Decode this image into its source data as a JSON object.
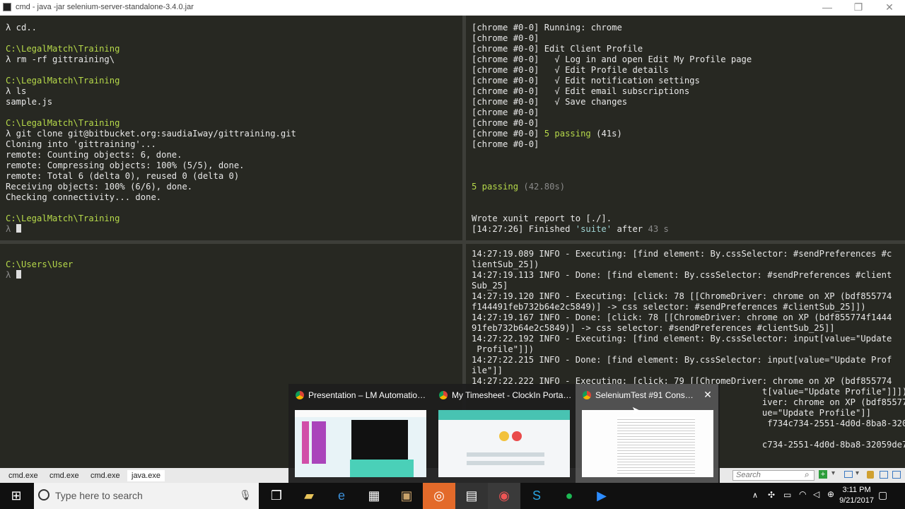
{
  "window": {
    "title": "cmd - java  -jar selenium-server-standalone-3.4.0.jar",
    "min_glyph": "—",
    "max_glyph": "❐",
    "close_glyph": "✕"
  },
  "top_left": [
    {
      "t": "λ cd..",
      "c": ""
    },
    {
      "t": "",
      "c": ""
    },
    {
      "t": "C:\\LegalMatch\\Training",
      "c": "green"
    },
    {
      "t": "λ rm -rf gittraining\\",
      "c": ""
    },
    {
      "t": "",
      "c": ""
    },
    {
      "t": "C:\\LegalMatch\\Training",
      "c": "green"
    },
    {
      "t": "λ ls",
      "c": ""
    },
    {
      "t": "sample.js",
      "c": ""
    },
    {
      "t": "",
      "c": ""
    },
    {
      "t": "C:\\LegalMatch\\Training",
      "c": "green"
    },
    {
      "t": "λ git clone git@bitbucket.org:saudiaIway/gittraining.git",
      "c": ""
    },
    {
      "t": "Cloning into 'gittraining'...",
      "c": ""
    },
    {
      "t": "remote: Counting objects: 6, done.",
      "c": ""
    },
    {
      "t": "remote: Compressing objects: 100% (5/5), done.",
      "c": ""
    },
    {
      "t": "remote: Total 6 (delta 0), reused 0 (delta 0)",
      "c": ""
    },
    {
      "t": "Receiving objects: 100% (6/6), done.",
      "c": ""
    },
    {
      "t": "Checking connectivity... done.",
      "c": ""
    },
    {
      "t": "",
      "c": ""
    },
    {
      "t": "C:\\LegalMatch\\Training",
      "c": "green"
    }
  ],
  "top_left_prompt": "λ ",
  "top_right": [
    {
      "t": "[chrome #0-0] Running: chrome",
      "c": ""
    },
    {
      "t": "[chrome #0-0]",
      "c": ""
    },
    {
      "t": "[chrome #0-0] Edit Client Profile",
      "c": ""
    },
    {
      "t": "[chrome #0-0]   √ Log in and open Edit My Profile page",
      "c": ""
    },
    {
      "t": "[chrome #0-0]   √ Edit Profile details",
      "c": ""
    },
    {
      "t": "[chrome #0-0]   √ Edit notification settings",
      "c": ""
    },
    {
      "t": "[chrome #0-0]   √ Edit email subscriptions",
      "c": ""
    },
    {
      "t": "[chrome #0-0]   √ Save changes",
      "c": ""
    },
    {
      "t": "[chrome #0-0]",
      "c": ""
    },
    {
      "t": "[chrome #0-0]",
      "c": ""
    },
    {
      "t": "[chrome #0-0] ",
      "c": "",
      "g": "5 passing",
      "r": " (41s)"
    },
    {
      "t": "[chrome #0-0]",
      "c": ""
    },
    {
      "t": "",
      "c": ""
    },
    {
      "t": "",
      "c": ""
    },
    {
      "t": "",
      "c": ""
    },
    {
      "t": "",
      "c": "",
      "g": "5 passing",
      "r": " (42.80s)",
      "rc": "grey"
    },
    {
      "t": "",
      "c": ""
    },
    {
      "t": "",
      "c": ""
    },
    {
      "t": "Wrote xunit report to [./].",
      "c": ""
    },
    {
      "t": "[14:27:26] Finished ",
      "c": "",
      "q": "'suite'",
      "r": " after ",
      "m": "43 s"
    }
  ],
  "bottom_left": [
    {
      "t": "C:\\Users\\User",
      "c": "green"
    }
  ],
  "bottom_left_prompt": "λ ",
  "bottom_right": [
    "14:27:19.089 INFO - Executing: [find element: By.cssSelector: #sendPreferences #c",
    "lientSub_25])",
    "14:27:19.113 INFO - Done: [find element: By.cssSelector: #sendPreferences #client",
    "Sub_25]",
    "14:27:19.120 INFO - Executing: [click: 78 [[ChromeDriver: chrome on XP (bdf855774",
    "f144491feb732b64e2c5849)] -> css selector: #sendPreferences #clientSub_25]])",
    "14:27:19.167 INFO - Done: [click: 78 [[ChromeDriver: chrome on XP (bdf855774f1444",
    "91feb732b64e2c5849)] -> css selector: #sendPreferences #clientSub_25]]",
    "14:27:22.192 INFO - Executing: [find element: By.cssSelector: input[value=\"Update",
    " Profile\"]])",
    "14:27:22.215 INFO - Done: [find element: By.cssSelector: input[value=\"Update Prof",
    "ile\"]]",
    "14:27:22.222 INFO - Executing: [click: 79 [[ChromeDriver: chrome on XP (bdf855774",
    "                                                        t[value=\"Update Profile\"]]])",
    "                                                        iver: chrome on XP (bdf855774f1444",
    "                                                        ue=\"Update Profile\"]]",
    "                                                         f734c734-2551-4d0d-8ba8-32059de78",
    "",
    "                                                        c734-2551-4d0d-8ba8-32059de789a7]"
  ],
  "tabs": [
    "cmd.exe",
    "cmd.exe",
    "cmd.exe",
    "java.exe"
  ],
  "active_tab": 3,
  "search_placeholder": "Search",
  "taskbar": {
    "search_placeholder": "Type here to search",
    "time": "3:11 PM",
    "date": "9/21/2017"
  },
  "previews": [
    {
      "title": "Presentation – LM Automation ..."
    },
    {
      "title": "My Timesheet - ClockIn Portal ..."
    },
    {
      "title": "SeleniumTest #91 Consol..."
    }
  ],
  "preview_close": "✕"
}
